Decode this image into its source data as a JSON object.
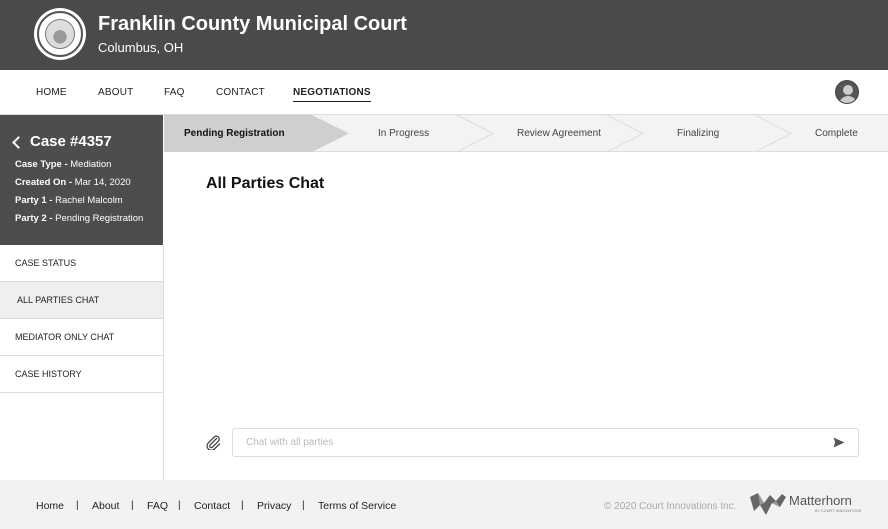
{
  "header": {
    "title": "Franklin County Municipal Court",
    "subtitle": "Columbus, OH"
  },
  "nav": {
    "items": [
      "HOME",
      "ABOUT",
      "FAQ",
      "CONTACT",
      "NEGOTIATIONS"
    ],
    "active": "NEGOTIATIONS"
  },
  "case": {
    "title": "Case #4357",
    "type_label": "Case Type -",
    "type_value": "Mediation",
    "created_label": "Created On -",
    "created_value": "Mar 14, 2020",
    "party1_label": "Party 1 -",
    "party1_value": "Rachel Malcolm",
    "party2_label": "Party 2 -",
    "party2_value": "Pending Registration"
  },
  "sidebar": {
    "items": [
      "CASE STATUS",
      "ALL PARTIES CHAT",
      "MEDIATOR ONLY CHAT",
      "CASE HISTORY"
    ],
    "active": "ALL PARTIES CHAT"
  },
  "steps": {
    "items": [
      "Pending Registration",
      "In Progress",
      "Review Agreement",
      "Finalizing",
      "Complete"
    ],
    "active": "Pending Registration"
  },
  "chat": {
    "title": "All Parties Chat",
    "input_placeholder": "Chat with all parties",
    "input_value": ""
  },
  "footer": {
    "links": [
      "Home",
      "About",
      "FAQ",
      "Contact",
      "Privacy",
      "Terms of Service"
    ],
    "separator": "|",
    "copyright": "© 2020 Court Innovations Inc.",
    "brand": "Matterhorn",
    "brand_tagline": "BY COURT INNOVATIONS"
  },
  "icons": {
    "seal": "county-seal-icon",
    "avatar": "user-avatar-icon",
    "back": "chevron-left-icon",
    "attach": "paperclip-icon",
    "send": "send-icon",
    "brand_logo": "matterhorn-logo-icon"
  },
  "colors": {
    "header_bg": "#4a4a4a",
    "case_box_bg": "#4d4d4d",
    "active_step_bg": "#cfcfcf",
    "footer_bg": "#f2f2f2"
  }
}
